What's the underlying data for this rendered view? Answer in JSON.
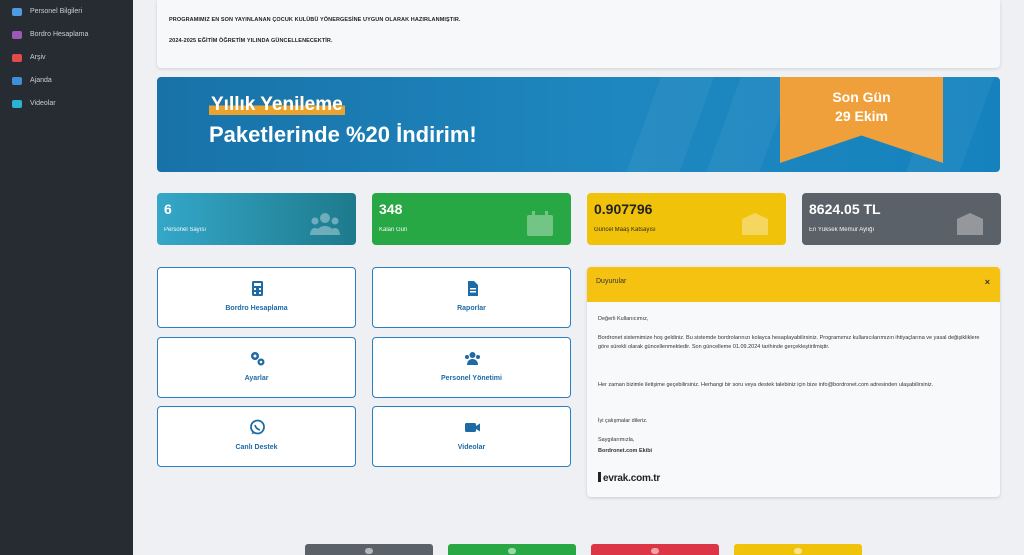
{
  "sidebar": {
    "items": [
      {
        "label": "Personel Bilgileri",
        "icon": "user-icon",
        "color": "#4e9be0"
      },
      {
        "label": "Bordro Hesaplama",
        "icon": "calculator-icon",
        "color": "#9b59b6"
      },
      {
        "label": "Arşiv",
        "icon": "archive-icon",
        "color": "#e04b4b"
      },
      {
        "label": "Ajanda",
        "icon": "calendar-icon",
        "color": "#3f8fd8"
      },
      {
        "label": "Videolar",
        "icon": "video-icon",
        "color": "#2bb3d6"
      }
    ]
  },
  "notice": {
    "line1": "PROGRAMIMIZ EN SON YAYINLANAN ÇOCUK KULÜBÜ YÖNERGESİNE UYGUN OLARAK HAZIRLANMIŞTIR.",
    "line2": "2024-2025 EĞİTİM ÖĞRETİM YILINDA GÜNCELLENECEKTİR."
  },
  "banner": {
    "line1": "Yıllık Yenileme",
    "line2": "Paketlerinde %20 İndirim!",
    "ribbon_line1": "Son Gün",
    "ribbon_line2": "29 Ekim"
  },
  "stats": [
    {
      "value": "6",
      "label": "Personel Sayısı",
      "icon": "users-icon"
    },
    {
      "value": "348",
      "label": "Kalan Gün",
      "icon": "calendar-icon"
    },
    {
      "value": "0.907796",
      "label": "Güncel Maaş Katsayısı",
      "icon": "box-icon"
    },
    {
      "value": "8624.05 TL",
      "label": "En Yüksek Memur Aylığı",
      "icon": "box-icon"
    }
  ],
  "actions": [
    {
      "label": "Bordro Hesaplama",
      "icon": "calculator-icon"
    },
    {
      "label": "Raporlar",
      "icon": "report-icon"
    },
    {
      "label": "Ayarlar",
      "icon": "settings-icon"
    },
    {
      "label": "Personel Yönetimi",
      "icon": "users-icon"
    },
    {
      "label": "Canlı Destek",
      "icon": "whatsapp-icon"
    },
    {
      "label": "Videolar",
      "icon": "video-icon"
    }
  ],
  "panel": {
    "title": "Duyurular",
    "close": "×",
    "greeting": "Değerli Kullanıcımız,",
    "p1": "Bordronet sistemimize hoş geldiniz. Bu sistemde bordrolarınızı kolayca hesaplayabilirsiniz. Programımız kullanıcılarımızın ihtiyaçlarına ve yasal değişikliklere göre sürekli olarak güncellenmektedir. Son güncelleme 01.09.2024 tarihinde gerçekleştirilmiştir.",
    "p2": "Her zaman bizimle iletişime geçebilirsiniz. Herhangi bir soru veya destek talebiniz için bize info@bordronet.com adresinden ulaşabilirsiniz.",
    "p3": "İyi çalışmalar dileriz.",
    "p4": "Saygılarımızla,",
    "p5": "Bordronet.com Ekibi",
    "logo": "evrak.com.tr"
  },
  "colors": {
    "sidebar": "#272c33",
    "banner": "#1e87bf",
    "ribbon": "#f0a03a",
    "info": "#35a7c9",
    "success": "#28a745",
    "warning": "#f0c20a",
    "secondary": "#5a6168",
    "accent": "#2a7fc0"
  },
  "bottom_buttons": [
    {
      "color": "#5a6168"
    },
    {
      "color": "#28a745"
    },
    {
      "color": "#dc3545"
    },
    {
      "color": "#f0c20a"
    }
  ]
}
